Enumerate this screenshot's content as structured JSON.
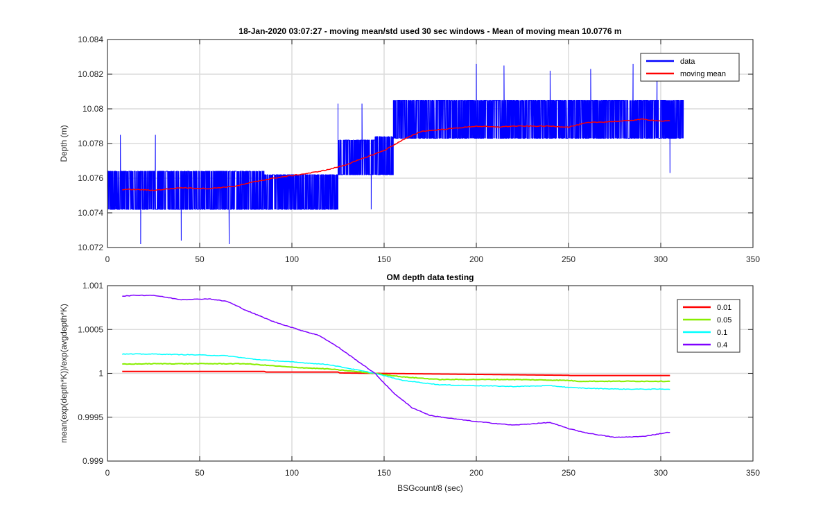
{
  "chart_data": [
    {
      "type": "line",
      "title": "18-Jan-2020 03:07:27 - moving mean/std used 30 sec windows - Mean of moving mean 10.0776 m",
      "xlabel": "",
      "ylabel": "Depth (m)",
      "xlim": [
        0,
        350
      ],
      "ylim": [
        10.072,
        10.084
      ],
      "xticks": [
        "0",
        "50",
        "100",
        "150",
        "200",
        "250",
        "300",
        "350"
      ],
      "yticks": [
        "10.072",
        "10.074",
        "10.076",
        "10.078",
        "10.08",
        "10.082",
        "10.084"
      ],
      "grid": true,
      "legend_position": "top-right",
      "series": [
        {
          "name": "data",
          "color": "#0000ff",
          "style": "noisy",
          "x_range": [
            0,
            312.5
          ],
          "bands": [
            {
              "x": [
                0,
                85
              ],
              "levels": [
                10.0742,
                10.0764
              ]
            },
            {
              "x": [
                85,
                125
              ],
              "levels": [
                10.0742,
                10.0762
              ]
            },
            {
              "x": [
                125,
                145
              ],
              "levels": [
                10.0762,
                10.0782
              ]
            },
            {
              "x": [
                145,
                155
              ],
              "levels": [
                10.0762,
                10.0784
              ]
            },
            {
              "x": [
                155,
                312.5
              ],
              "levels": [
                10.0783,
                10.0805
              ]
            }
          ],
          "spikes": [
            {
              "x": 18,
              "y": 10.0722
            },
            {
              "x": 40,
              "y": 10.0724
            },
            {
              "x": 66,
              "y": 10.0722
            },
            {
              "x": 125,
              "y": 10.0803
            },
            {
              "x": 138,
              "y": 10.0803
            },
            {
              "x": 143,
              "y": 10.0742
            },
            {
              "x": 200,
              "y": 10.0826
            },
            {
              "x": 215,
              "y": 10.0825
            },
            {
              "x": 240,
              "y": 10.0822
            },
            {
              "x": 262,
              "y": 10.0823
            },
            {
              "x": 285,
              "y": 10.0826
            },
            {
              "x": 298,
              "y": 10.0825
            },
            {
              "x": 305,
              "y": 10.0763
            },
            {
              "x": 7,
              "y": 10.0785
            },
            {
              "x": 26,
              "y": 10.0785
            }
          ]
        },
        {
          "name": "moving mean",
          "color": "#ff0000",
          "x": [
            8,
            15,
            25,
            40,
            55,
            70,
            80,
            90,
            100,
            110,
            120,
            130,
            140,
            150,
            160,
            170,
            180,
            190,
            200,
            210,
            220,
            230,
            240,
            250,
            260,
            270,
            280,
            290,
            300,
            305
          ],
          "y": [
            10.07535,
            10.07535,
            10.0753,
            10.07545,
            10.0754,
            10.07555,
            10.0758,
            10.076,
            10.07615,
            10.0763,
            10.0765,
            10.0768,
            10.0772,
            10.0776,
            10.0782,
            10.0787,
            10.0788,
            10.0789,
            10.079,
            10.07895,
            10.079,
            10.079,
            10.079,
            10.07895,
            10.0792,
            10.07925,
            10.0793,
            10.0794,
            10.0793,
            10.0793
          ]
        }
      ]
    },
    {
      "type": "line",
      "title": "OM depth data testing",
      "xlabel": "BSGcount/8 (sec)",
      "ylabel": "mean(exp(depth*K))/exp(avgdepth*K)",
      "xlim": [
        0,
        350
      ],
      "ylim": [
        0.999,
        1.001
      ],
      "xticks": [
        "0",
        "50",
        "100",
        "150",
        "200",
        "250",
        "300",
        "350"
      ],
      "yticks": [
        "0.999",
        "0.9995",
        "1",
        "1.0005",
        "1.001"
      ],
      "grid": true,
      "legend_position": "top-right",
      "series": [
        {
          "name": "0.01",
          "color": "#ff0000",
          "x": [
            8,
            85,
            86,
            125,
            126,
            145,
            250,
            251,
            305
          ],
          "y": [
            1.000022,
            1.000022,
            1.000015,
            1.000015,
            1.000005,
            1.0,
            0.999978,
            0.999975,
            0.999975
          ]
        },
        {
          "name": "0.05",
          "color": "#88ee00",
          "x": [
            8,
            25,
            50,
            75,
            100,
            120,
            135,
            145,
            160,
            180,
            200,
            220,
            250,
            255,
            280,
            305
          ],
          "y": [
            1.000105,
            1.00011,
            1.00011,
            1.00011,
            1.00007,
            1.00005,
            1.00002,
            1.0,
            0.99996,
            0.99993,
            0.99993,
            0.99993,
            0.99992,
            0.99991,
            0.99991,
            0.99991
          ]
        },
        {
          "name": "0.1",
          "color": "#00ffff",
          "x": [
            8,
            25,
            50,
            65,
            80,
            100,
            120,
            135,
            145,
            160,
            180,
            200,
            220,
            240,
            250,
            260,
            280,
            305
          ],
          "y": [
            1.00022,
            1.00022,
            1.00021,
            1.0002,
            1.00016,
            1.00013,
            1.0001,
            1.00004,
            1.0,
            0.99992,
            0.99987,
            0.99986,
            0.99985,
            0.99986,
            0.99984,
            0.99983,
            0.99982,
            0.99982
          ]
        },
        {
          "name": "0.4",
          "color": "#7f00ff",
          "x": [
            8,
            15,
            25,
            40,
            55,
            65,
            75,
            90,
            105,
            115,
            125,
            135,
            145,
            155,
            165,
            175,
            185,
            200,
            210,
            220,
            240,
            250,
            260,
            275,
            290,
            305
          ],
          "y": [
            1.00088,
            1.00089,
            1.00089,
            1.00084,
            1.00085,
            1.00082,
            1.00072,
            1.00059,
            1.00049,
            1.00043,
            1.0003,
            1.00015,
            1.0,
            0.99978,
            0.99961,
            0.99952,
            0.99949,
            0.99945,
            0.99943,
            0.99941,
            0.99944,
            0.99937,
            0.99932,
            0.99927,
            0.99928,
            0.99933
          ]
        }
      ]
    }
  ]
}
